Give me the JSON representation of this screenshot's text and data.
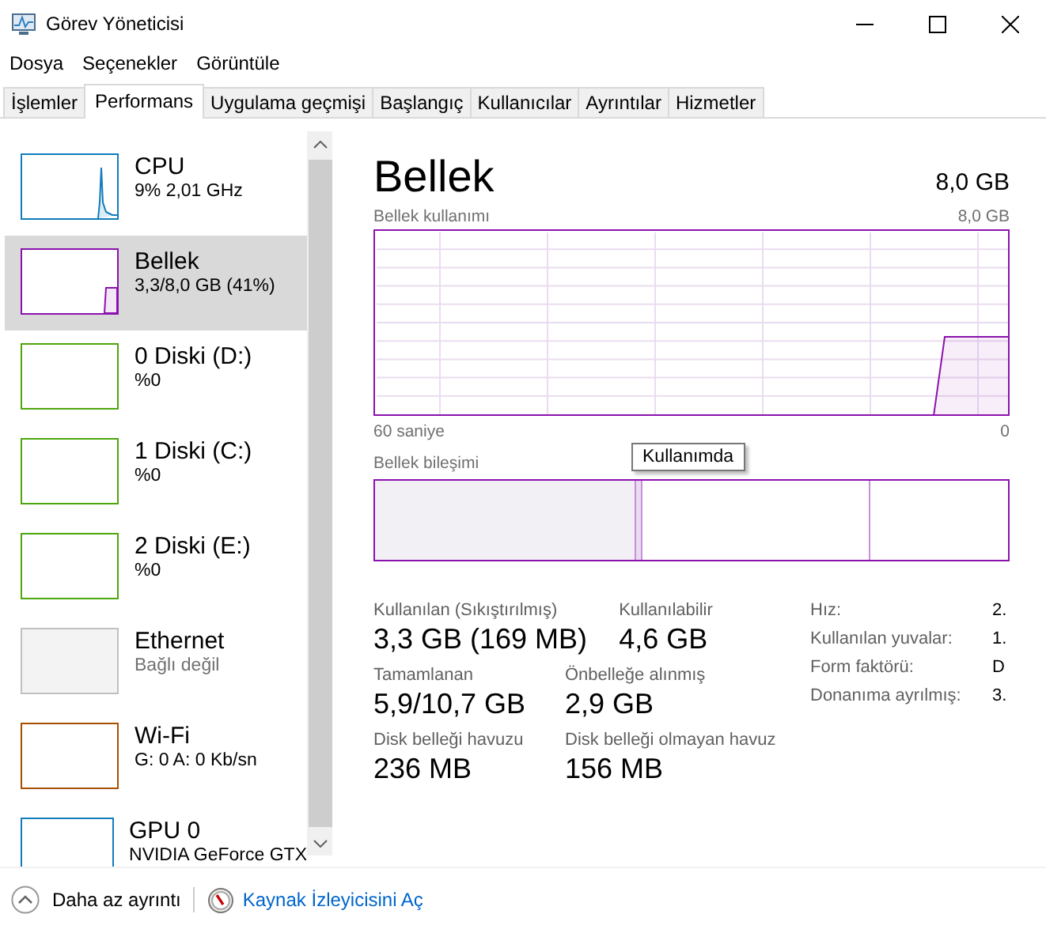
{
  "window": {
    "title": "Görev Yöneticisi"
  },
  "menu": [
    "Dosya",
    "Seçenekler",
    "Görüntüle"
  ],
  "tabs": [
    {
      "label": "İşlemler",
      "selected": false
    },
    {
      "label": "Performans",
      "selected": true
    },
    {
      "label": "Uygulama geçmişi",
      "selected": false
    },
    {
      "label": "Başlangıç",
      "selected": false
    },
    {
      "label": "Kullanıcılar",
      "selected": false
    },
    {
      "label": "Ayrıntılar",
      "selected": false
    },
    {
      "label": "Hizmetler",
      "selected": false
    }
  ],
  "sidebar": {
    "items": [
      {
        "kind": "cpu",
        "name": "CPU",
        "detail": "9% 2,01 GHz",
        "color": "#117dbb",
        "selected": false,
        "disabled": false
      },
      {
        "kind": "memory",
        "name": "Bellek",
        "detail": "3,3/8,0 GB (41%)",
        "color": "#8b12ae",
        "selected": true,
        "disabled": false
      },
      {
        "kind": "disk",
        "name": "0 Diski (D:)",
        "detail": "%0",
        "color": "#4da60c",
        "selected": false,
        "disabled": false
      },
      {
        "kind": "disk",
        "name": "1 Diski (C:)",
        "detail": "%0",
        "color": "#4da60c",
        "selected": false,
        "disabled": false
      },
      {
        "kind": "disk",
        "name": "2 Diski (E:)",
        "detail": "%0",
        "color": "#4da60c",
        "selected": false,
        "disabled": false
      },
      {
        "kind": "ethernet",
        "name": "Ethernet",
        "detail": "Bağlı değil",
        "color": "#c0c0c0",
        "selected": false,
        "disabled": true
      },
      {
        "kind": "wifi",
        "name": "Wi-Fi",
        "detail": "G: 0 A: 0 Kb/sn",
        "color": "#a74f01",
        "selected": false,
        "disabled": false
      },
      {
        "kind": "gpu",
        "name": "GPU 0",
        "detail": "NVIDIA GeForce GTX",
        "color": "#117dbb",
        "selected": false,
        "disabled": false
      }
    ]
  },
  "panel": {
    "title": "Bellek",
    "total": "8,0 GB",
    "usage_chart": {
      "label": "Bellek kullanımı",
      "max": "8,0 GB",
      "x_start": "60 saniye",
      "x_end": "0"
    },
    "composition": {
      "label": "Bellek bileşimi",
      "tooltip": "Kullanımda"
    },
    "stats": [
      [
        {
          "label": "Kullanılan (Sıkıştırılmış)",
          "value": "3,3 GB (169 MB)"
        },
        {
          "label": "Kullanılabilir",
          "value": "4,6 GB"
        }
      ],
      [
        {
          "label": "Tamamlanan",
          "value": "5,9/10,7 GB"
        },
        {
          "label": "Önbelleğe alınmış",
          "value": "2,9 GB"
        }
      ],
      [
        {
          "label": "Disk belleği havuzu",
          "value": "236 MB"
        },
        {
          "label": "Disk belleği olmayan havuz",
          "value": "156 MB"
        }
      ]
    ],
    "details": [
      {
        "label": "Hız:",
        "value": "2."
      },
      {
        "label": "Kullanılan yuvalar:",
        "value": "1."
      },
      {
        "label": "Form faktörü:",
        "value": "D"
      },
      {
        "label": "Donanıma ayrılmış:",
        "value": "3."
      }
    ]
  },
  "footer": {
    "toggle": "Daha az ayrıntı",
    "link": "Kaynak İzleyicisini Aç"
  }
}
